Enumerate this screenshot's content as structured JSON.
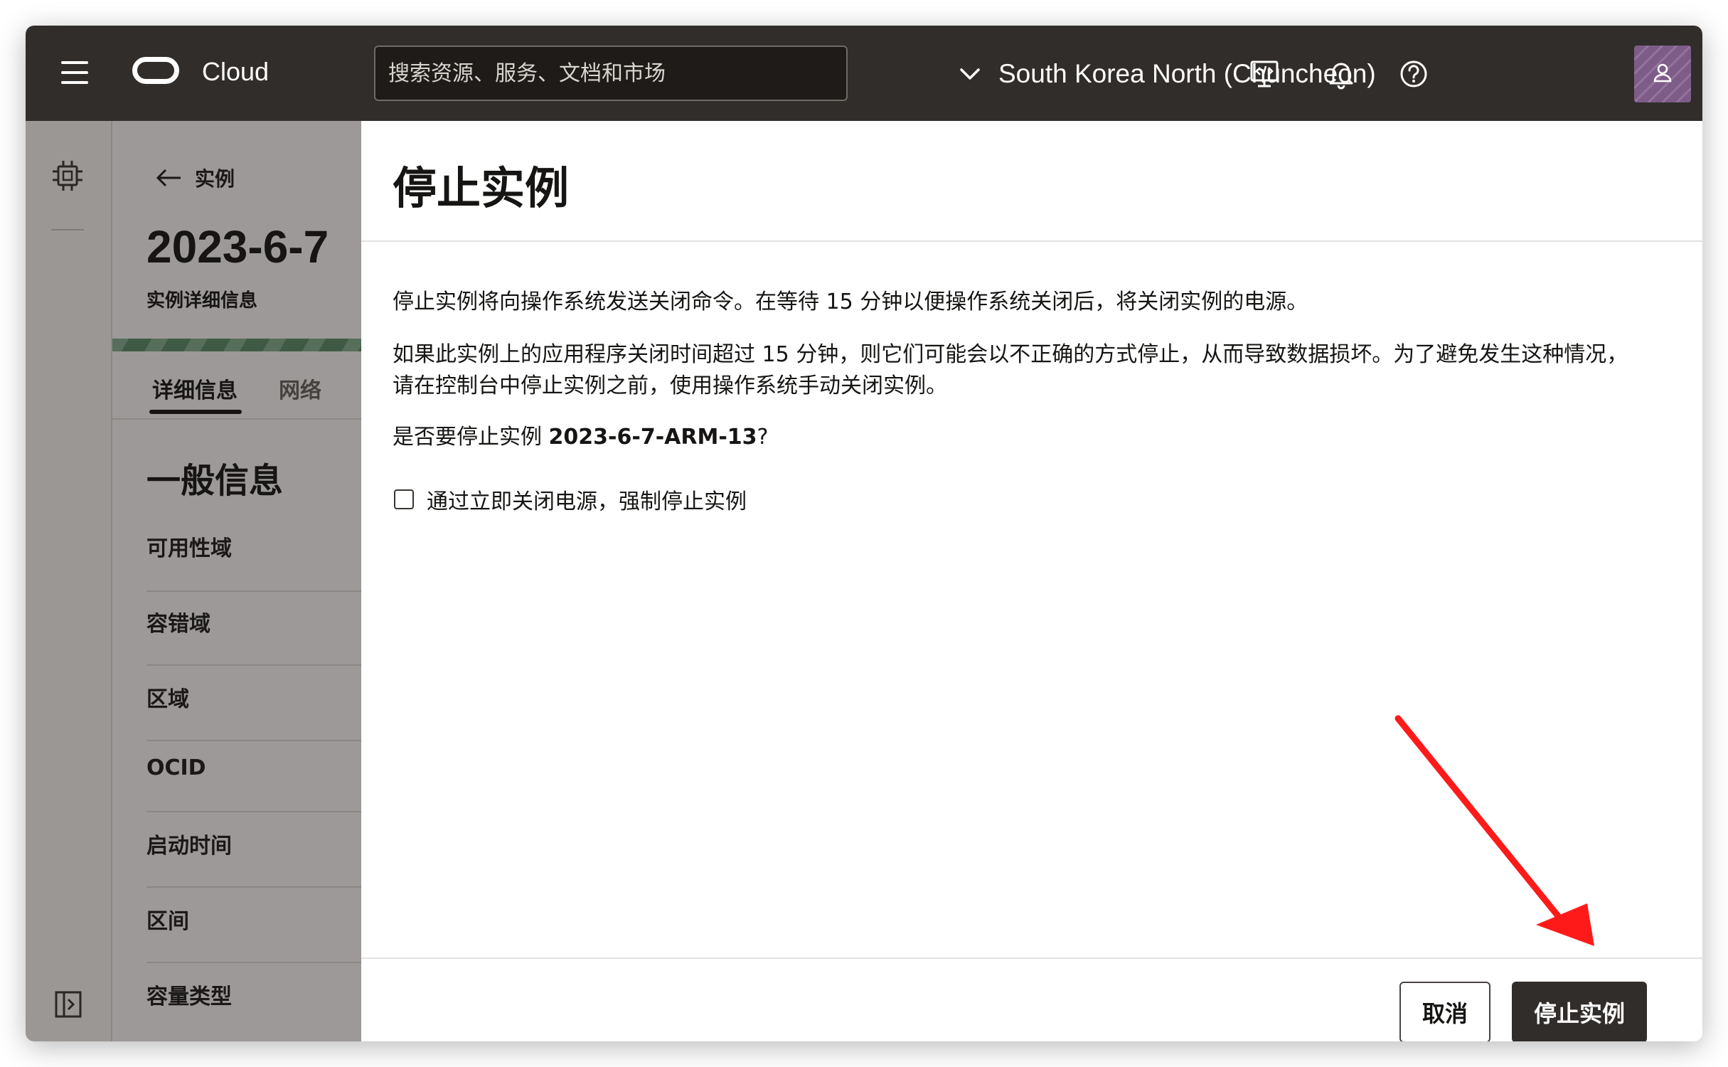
{
  "topbar": {
    "brand": "Cloud",
    "search_placeholder": "搜索资源、服务、文档和市场",
    "region": "South Korea North (Chuncheon)"
  },
  "instance_page": {
    "back_label": "实例",
    "title": "2023-6-7",
    "subtitle": "实例详细信息",
    "tabs": [
      {
        "label": "详细信息",
        "active": true
      },
      {
        "label": "网络",
        "active": false
      }
    ],
    "section_title": "一般信息",
    "fields": [
      "可用性域",
      "容错域",
      "区域",
      "OCID",
      "启动时间",
      "区间",
      "容量类型"
    ]
  },
  "dialog": {
    "title": "停止实例",
    "para1": "停止实例将向操作系统发送关闭命令。在等待 15 分钟以便操作系统关闭后，将关闭实例的电源。",
    "para2_line1": "如果此实例上的应用程序关闭时间超过 15 分钟，则它们可能会以不正确的方式停止，从而导致数据损坏。为了避免发生这种情况，",
    "para2_line2": "请在控制台中停止实例之前，使用操作系统手动关闭实例。",
    "question_prefix": "是否要停止实例 ",
    "instance_name": "2023-6-7-ARM-13",
    "question_suffix": "?",
    "force_checkbox_label": "通过立即关闭电源，强制停止实例",
    "force_checkbox_checked": false,
    "cancel_label": "取消",
    "stop_label": "停止实例"
  },
  "colors": {
    "topbar": "#312d2a",
    "primary_button": "#312d2a",
    "annotation_arrow": "#ff1a1a",
    "avatar": "#7e5c88"
  }
}
